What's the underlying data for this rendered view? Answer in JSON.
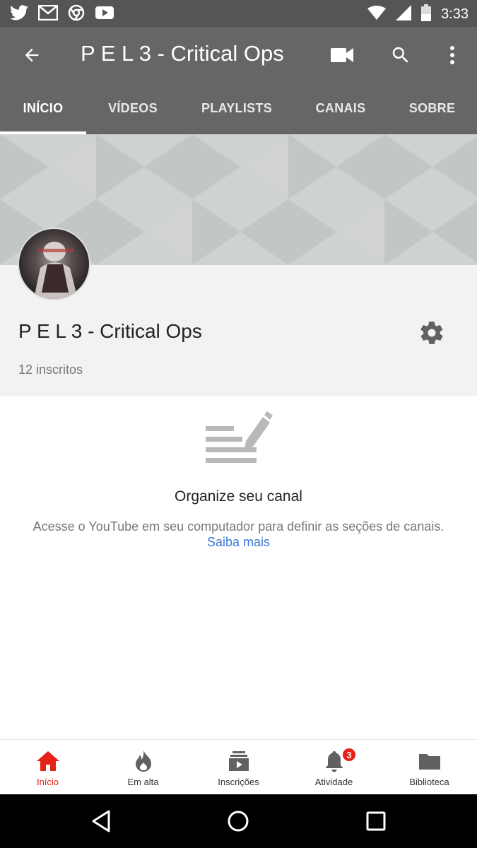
{
  "status_bar": {
    "time": "3:33",
    "left_icons": [
      "twitter-icon",
      "gmail-icon",
      "chrome-icon",
      "youtube-icon"
    ],
    "right_icons": [
      "wifi-icon",
      "signal-icon",
      "battery-icon"
    ]
  },
  "app_bar": {
    "title": "P E L 3 - Critical Ops"
  },
  "tabs": [
    {
      "label": "INÍCIO",
      "active": true
    },
    {
      "label": "VÍDEOS",
      "active": false
    },
    {
      "label": "PLAYLISTS",
      "active": false
    },
    {
      "label": "CANAIS",
      "active": false
    },
    {
      "label": "SOBRE",
      "active": false
    }
  ],
  "channel": {
    "name": "P E L 3 - Critical Ops",
    "subscribers": "12 inscritos"
  },
  "empty_state": {
    "title": "Organize seu canal",
    "description": "Acesse o YouTube em seu computador para definir as seções de canais.",
    "link": "Saiba mais"
  },
  "bottom_nav": [
    {
      "label": "Início",
      "icon": "home-icon",
      "active": true
    },
    {
      "label": "Em alta",
      "icon": "fire-icon",
      "active": false
    },
    {
      "label": "Inscrições",
      "icon": "subscriptions-icon",
      "active": false
    },
    {
      "label": "Atividade",
      "icon": "bell-icon",
      "active": false,
      "badge": "3"
    },
    {
      "label": "Biblioteca",
      "icon": "folder-icon",
      "active": false
    }
  ],
  "colors": {
    "app_bar": "#666666",
    "accent_red": "#e62117",
    "link_blue": "#3a78d6"
  }
}
